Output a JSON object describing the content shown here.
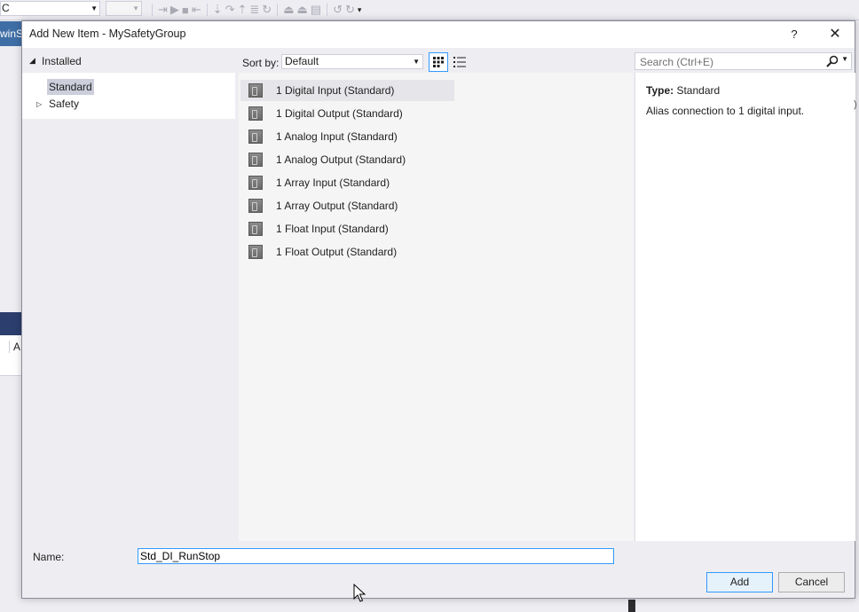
{
  "background": {
    "config_combo": "C",
    "side_tab": "winSa",
    "panel_text": "A"
  },
  "dialog": {
    "title": "Add New Item - MySafetyGroup",
    "help": "?",
    "close": "✕"
  },
  "tree": {
    "header": "Installed",
    "items": [
      {
        "label": "Standard",
        "selected": true
      },
      {
        "label": "Safety",
        "selected": false
      }
    ]
  },
  "sort": {
    "label": "Sort by:",
    "value": "Default"
  },
  "search": {
    "placeholder": "Search (Ctrl+E)"
  },
  "items": [
    "1 Digital Input (Standard)",
    "1 Digital Output (Standard)",
    "1 Analog Input (Standard)",
    "1 Analog Output (Standard)",
    "1 Array Input (Standard)",
    "1 Array Output (Standard)",
    "1 Float Input (Standard)",
    "1 Float Output (Standard)"
  ],
  "details": {
    "type_label": "Type:",
    "type_value": "Standard",
    "description": "Alias connection to 1 digital input."
  },
  "name_field": {
    "label": "Name:",
    "value": "Std_DI_RunStop"
  },
  "buttons": {
    "add": "Add",
    "cancel": "Cancel"
  },
  "colors": {
    "accent": "#3399ff",
    "selection": "#cccedb",
    "dialog_bg": "#eeeef2"
  }
}
